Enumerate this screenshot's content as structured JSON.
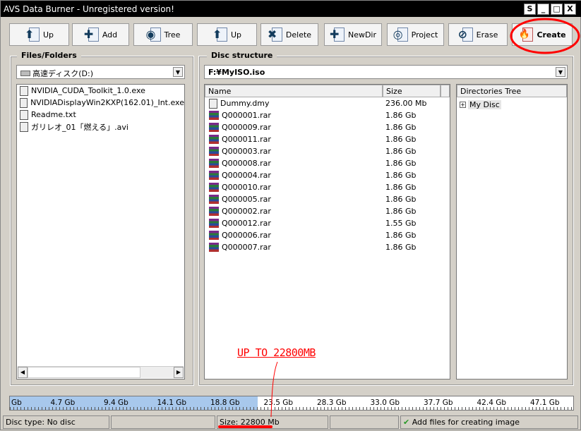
{
  "window": {
    "title": "AVS Data Burner - Unregistered version!",
    "controls": [
      "S",
      "_",
      "□",
      "X"
    ]
  },
  "toolbar": [
    {
      "label": "Up",
      "icon": "up-arrow-icon",
      "glyph": "⬆"
    },
    {
      "label": "Add",
      "icon": "add-icon",
      "glyph": "✚"
    },
    {
      "label": "Tree",
      "icon": "tree-eye-icon",
      "glyph": "◉"
    },
    {
      "label": "Up",
      "icon": "up-arrow-icon",
      "glyph": "⬆"
    },
    {
      "label": "Delete",
      "icon": "delete-icon",
      "glyph": "✖"
    },
    {
      "label": "NewDir",
      "icon": "new-folder-icon",
      "glyph": "✚"
    },
    {
      "label": "Project",
      "icon": "project-disc-icon",
      "glyph": "◎"
    },
    {
      "label": "Erase",
      "icon": "erase-icon",
      "glyph": "⊘"
    },
    {
      "label": "Create",
      "icon": "flame-icon",
      "glyph": "🔥"
    }
  ],
  "files_panel": {
    "title": "Files/Folders",
    "drive": "高速ディスク(D:)",
    "items": [
      "NVIDIA_CUDA_Toolkit_1.0.exe",
      "NVIDIADisplayWin2KXP(162.01)_Int.exe",
      "Readme.txt",
      "ガリレオ_01「燃える」.avi"
    ]
  },
  "disc_panel": {
    "title": "Disc structure",
    "path": "F:¥MyISO.iso",
    "columns": [
      "Name",
      "Size"
    ],
    "rows": [
      [
        "Dummy.dmy",
        "236.00 Mb"
      ],
      [
        "Q000001.rar",
        "1.86 Gb"
      ],
      [
        "Q000009.rar",
        "1.86 Gb"
      ],
      [
        "Q000011.rar",
        "1.86 Gb"
      ],
      [
        "Q000003.rar",
        "1.86 Gb"
      ],
      [
        "Q000008.rar",
        "1.86 Gb"
      ],
      [
        "Q000004.rar",
        "1.86 Gb"
      ],
      [
        "Q000010.rar",
        "1.86 Gb"
      ],
      [
        "Q000005.rar",
        "1.86 Gb"
      ],
      [
        "Q000002.rar",
        "1.86 Gb"
      ],
      [
        "Q000012.rar",
        "1.55 Gb"
      ],
      [
        "Q000006.rar",
        "1.86 Gb"
      ],
      [
        "Q000007.rar",
        "1.86 Gb"
      ]
    ],
    "tree_header": "Directories Tree",
    "tree_root": "My Disc",
    "tree_expander": "+"
  },
  "ruler": {
    "ticks": [
      "Gb",
      "4.7 Gb",
      "9.4 Gb",
      "14.1 Gb",
      "18.8 Gb",
      "23.5 Gb",
      "28.3 Gb",
      "33.0 Gb",
      "37.7 Gb",
      "42.4 Gb",
      "47.1 Gb"
    ],
    "fill_fraction": 0.44
  },
  "status": {
    "disc_type": "Disc type: No disc",
    "size": "Size: 22800 Mb",
    "message": "Add files for creating image"
  },
  "annotation": {
    "text": "UP TO 22800MB",
    "color": "#ff0000"
  }
}
